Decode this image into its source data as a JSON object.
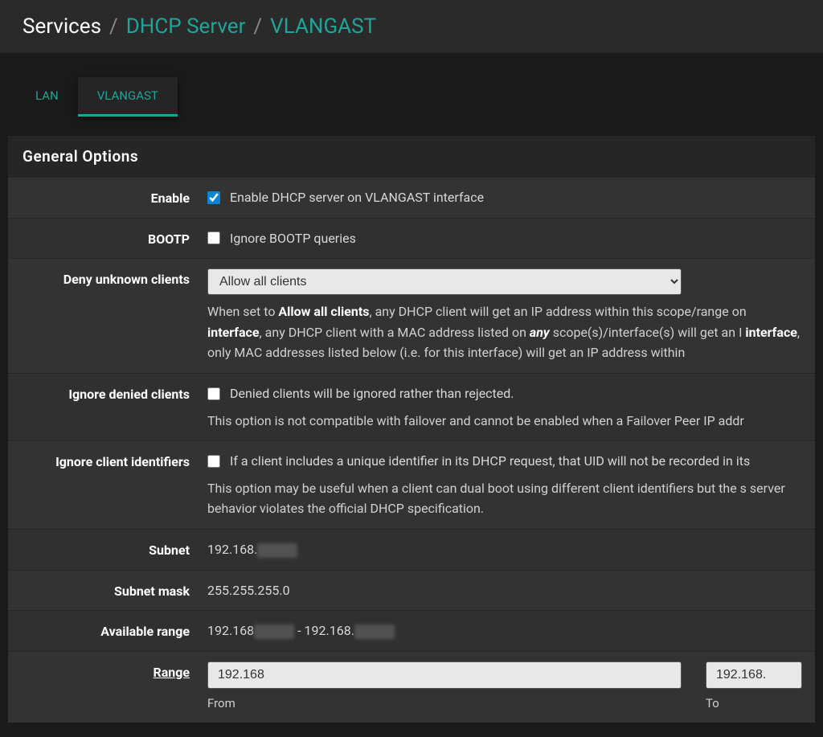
{
  "breadcrumb": {
    "root": "Services",
    "level1": "DHCP Server",
    "level2": "VLANGAST"
  },
  "tabs": {
    "items": [
      {
        "label": "LAN",
        "active": false
      },
      {
        "label": "VLANGAST",
        "active": true
      }
    ]
  },
  "panel": {
    "title": "General Options"
  },
  "fields": {
    "enable": {
      "label": "Enable",
      "checkbox_label": "Enable DHCP server on VLANGAST interface",
      "checked": true
    },
    "bootp": {
      "label": "BOOTP",
      "checkbox_label": "Ignore BOOTP queries",
      "checked": false
    },
    "deny_unknown": {
      "label": "Deny unknown clients",
      "select_value": "Allow all clients",
      "help_pre": "When set to ",
      "help_b1": "Allow all clients",
      "help_mid1": ", any DHCP client will get an IP address within this scope/range on",
      "help_b2": "interface",
      "help_mid2": ", any DHCP client with a MAC address listed on ",
      "help_b3": "any",
      "help_mid3": " scope(s)/interface(s) will get an I",
      "help_b4": "interface",
      "help_end": ", only MAC addresses listed below (i.e. for this interface) will get an IP address within"
    },
    "ignore_denied": {
      "label": "Ignore denied clients",
      "checkbox_label": "Denied clients will be ignored rather than rejected.",
      "checked": false,
      "help": "This option is not compatible with failover and cannot be enabled when a Failover Peer IP addr"
    },
    "ignore_cid": {
      "label": "Ignore client identifiers",
      "checkbox_label": "If a client includes a unique identifier in its DHCP request, that UID will not be recorded in its",
      "checked": false,
      "help": "This option may be useful when a client can dual boot using different client identifiers but the s server behavior violates the official DHCP specification."
    },
    "subnet": {
      "label": "Subnet",
      "value": "192.168."
    },
    "subnet_mask": {
      "label": "Subnet mask",
      "value": "255.255.255.0"
    },
    "available_range": {
      "label": "Available range",
      "value_a": "192.168",
      "value_sep": " - ",
      "value_b": "192.168."
    },
    "range": {
      "label": "Range",
      "from_value": "192.168",
      "from_label": "From",
      "to_value": "192.168.",
      "to_label": "To"
    }
  }
}
